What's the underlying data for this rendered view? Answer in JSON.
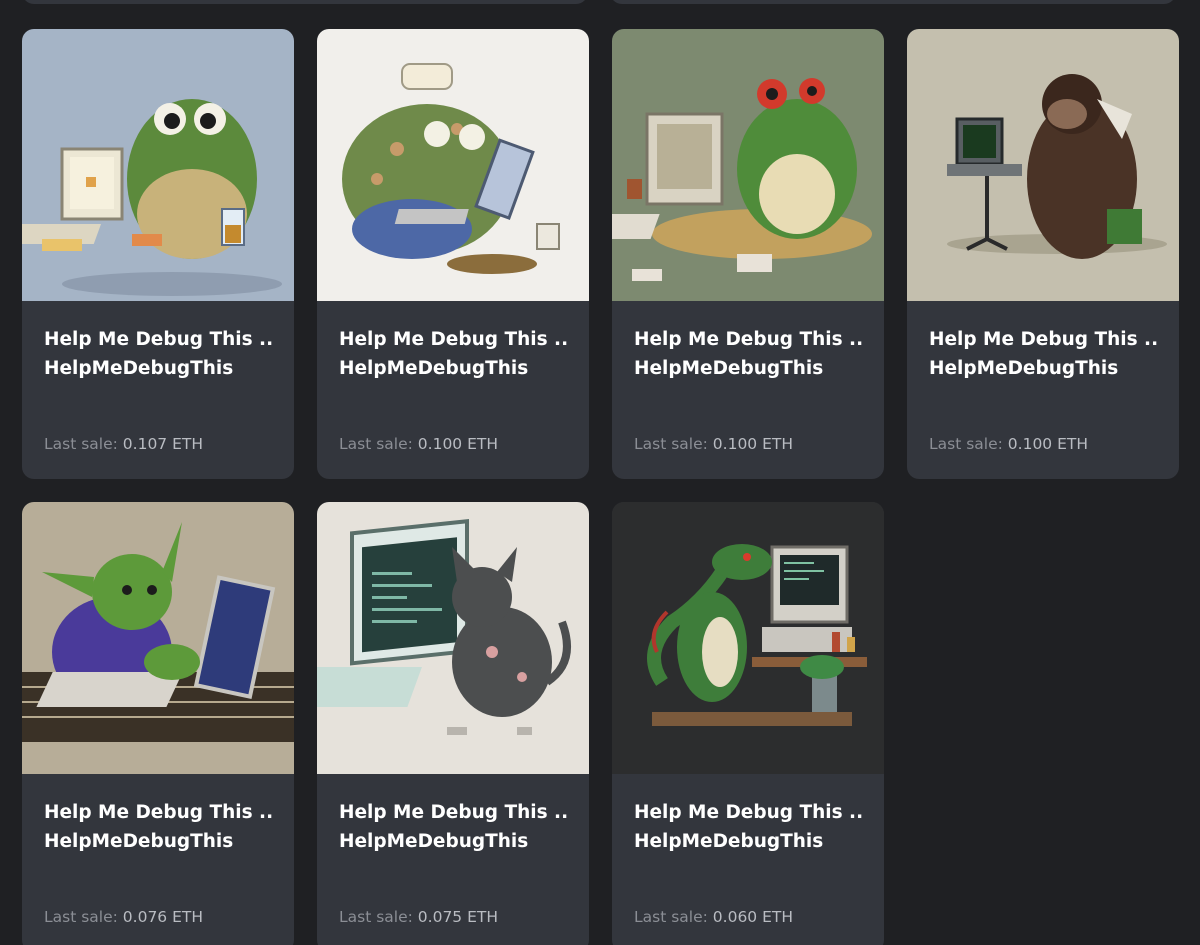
{
  "grid": {
    "items": [
      {
        "title": "Help Me Debug This ...",
        "collection": "HelpMeDebugThis",
        "sale_label": "Last sale:",
        "price": "0.107 ETH",
        "image": "pixel-art-toad-with-computer",
        "bg": "#a5b4c6"
      },
      {
        "title": "Help Me Debug This ...",
        "collection": "HelpMeDebugThis",
        "sale_label": "Last sale:",
        "price": "0.100 ETH",
        "image": "pixel-art-frog-with-laptop",
        "bg": "#f1efeb"
      },
      {
        "title": "Help Me Debug This ...",
        "collection": "HelpMeDebugThis",
        "sale_label": "Last sale:",
        "price": "0.100 ETH",
        "image": "pixel-art-frog-with-crt-computer",
        "bg": "#7d8a70"
      },
      {
        "title": "Help Me Debug This ...",
        "collection": "HelpMeDebugThis",
        "sale_label": "Last sale:",
        "price": "0.100 ETH",
        "image": "pixel-art-gorilla-with-laptop",
        "bg": "#c4bfae"
      },
      {
        "title": "Help Me Debug This ...",
        "collection": "HelpMeDebugThis",
        "sale_label": "Last sale:",
        "price": "0.076 ETH",
        "image": "pixel-art-goblin-with-laptop",
        "bg": "#b7ad98"
      },
      {
        "title": "Help Me Debug This ...",
        "collection": "HelpMeDebugThis",
        "sale_label": "Last sale:",
        "price": "0.075 ETH",
        "image": "pixel-art-cat-with-computer",
        "bg": "#e6e2db"
      },
      {
        "title": "Help Me Debug This ...",
        "collection": "HelpMeDebugThis",
        "sale_label": "Last sale:",
        "price": "0.060 ETH",
        "image": "pixel-art-dinosaur-with-computer",
        "bg": "#2c2d2e"
      }
    ]
  }
}
